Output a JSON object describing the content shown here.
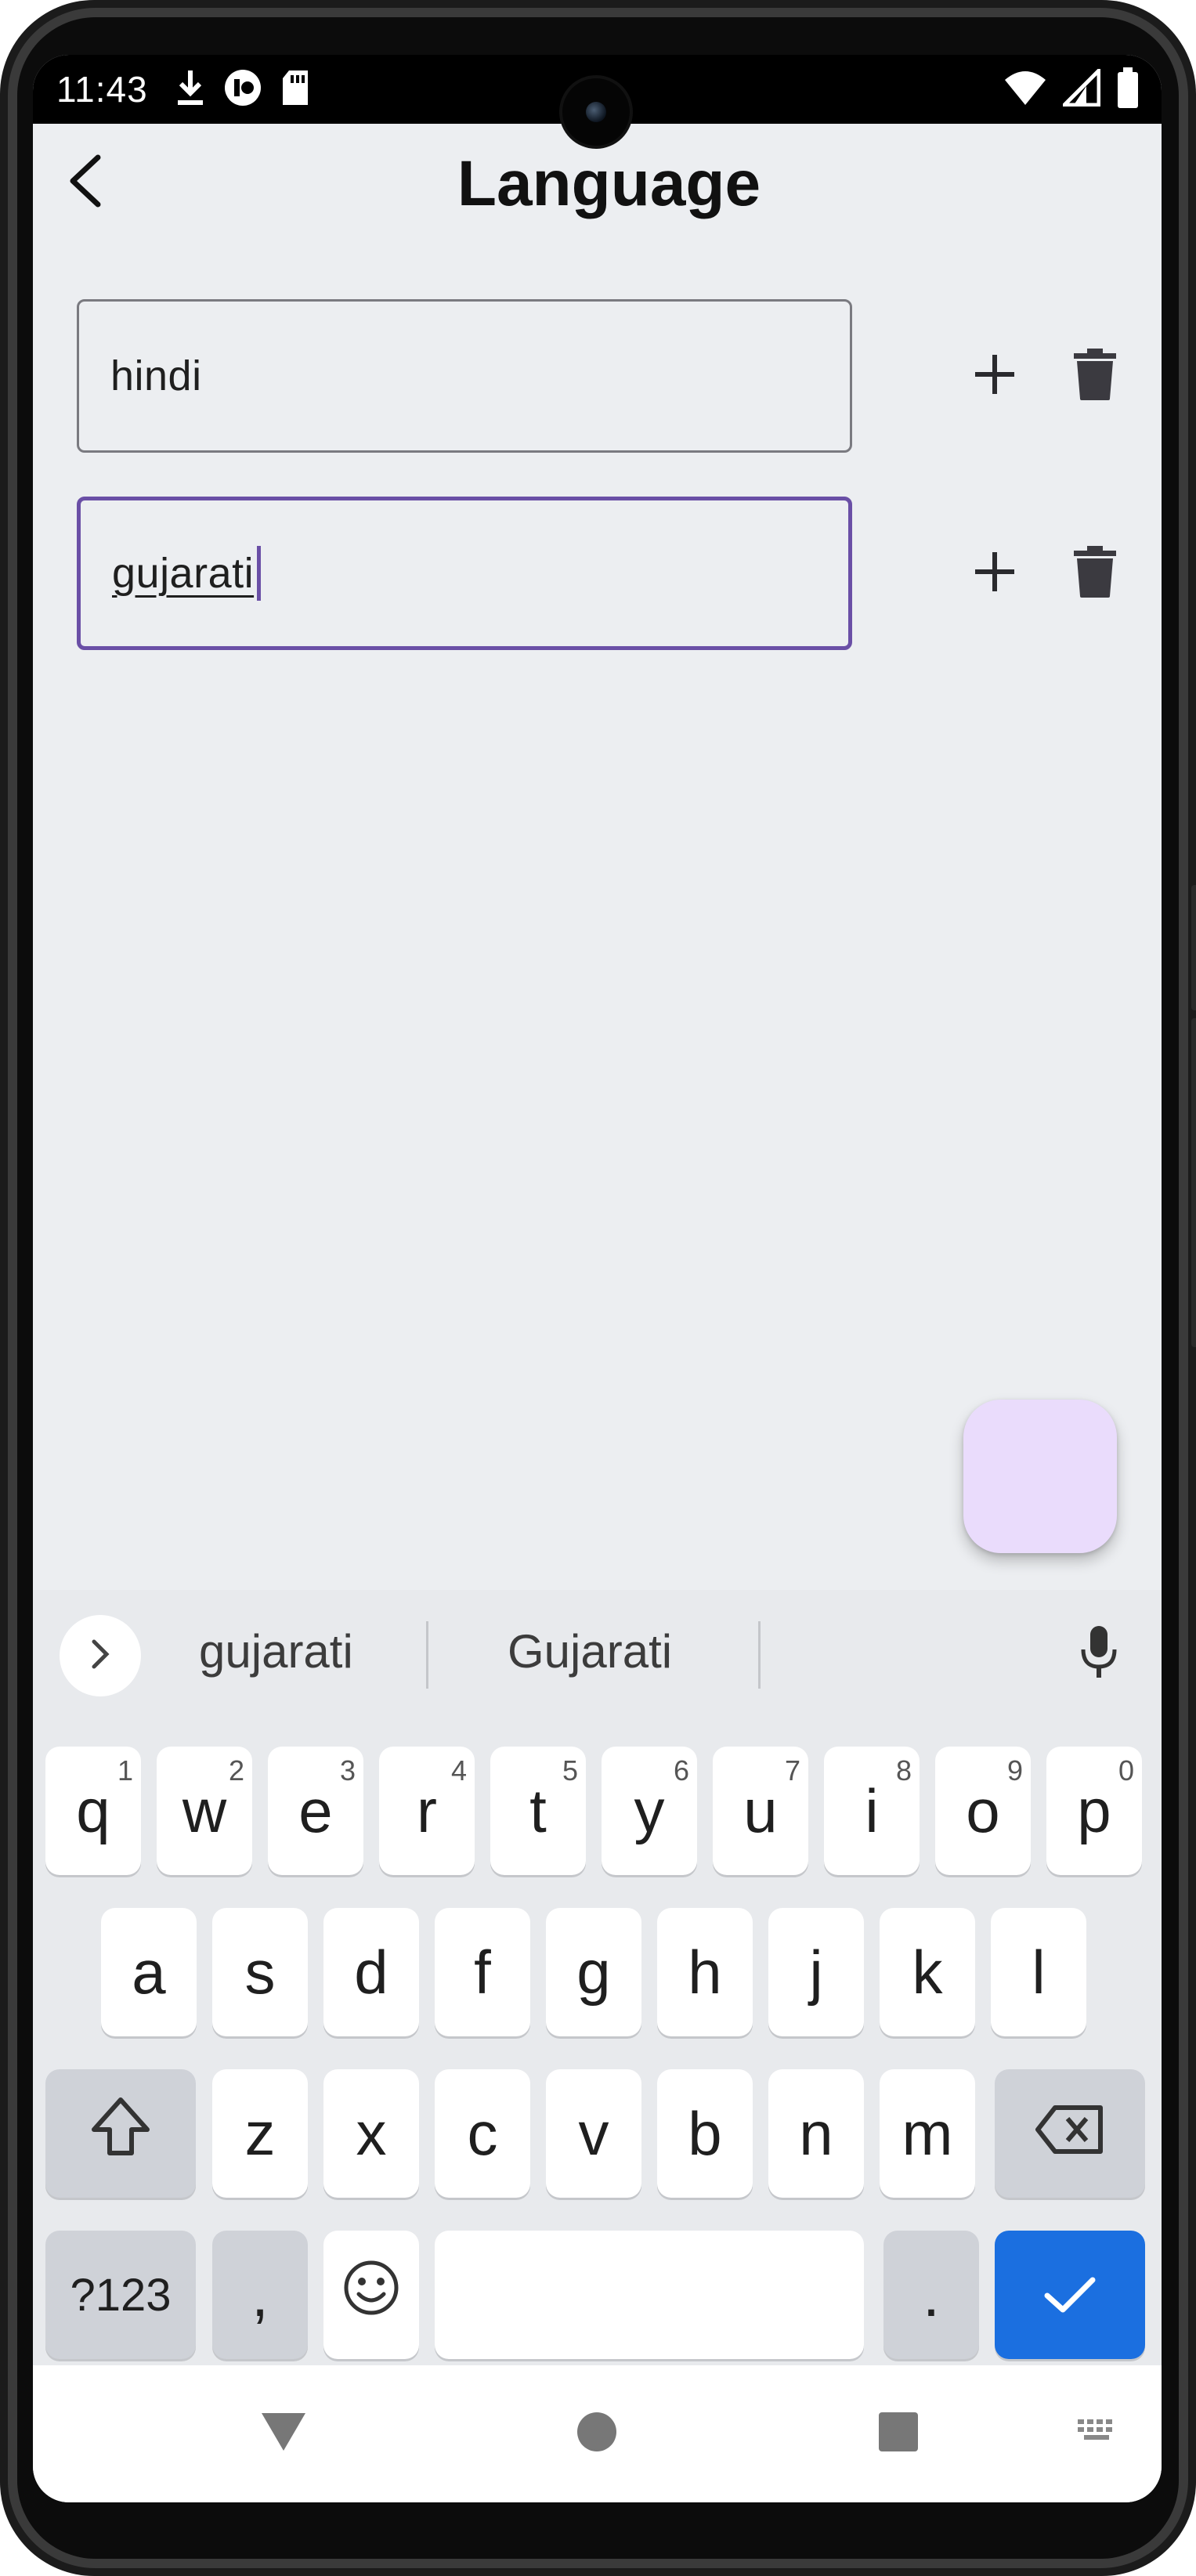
{
  "status_bar": {
    "time": "11:43",
    "left_icons": [
      "download-icon",
      "app-notification-icon",
      "sd-card-icon"
    ],
    "right_icons": [
      "wifi-icon",
      "cell-signal-icon",
      "battery-icon"
    ]
  },
  "app_bar": {
    "title": "Language",
    "back_icon": "back-arrow-icon"
  },
  "languages": [
    {
      "value": "hindi",
      "focused": false
    },
    {
      "value": "gujarati",
      "focused": true
    }
  ],
  "row_actions": {
    "add_icon": "plus-icon",
    "delete_icon": "trash-icon"
  },
  "fab": {
    "color": "#eadcfc"
  },
  "keyboard": {
    "suggestions": [
      "gujarati",
      "Gujarati"
    ],
    "row1": [
      {
        "label": "q",
        "hint": "1"
      },
      {
        "label": "w",
        "hint": "2"
      },
      {
        "label": "e",
        "hint": "3"
      },
      {
        "label": "r",
        "hint": "4"
      },
      {
        "label": "t",
        "hint": "5"
      },
      {
        "label": "y",
        "hint": "6"
      },
      {
        "label": "u",
        "hint": "7"
      },
      {
        "label": "i",
        "hint": "8"
      },
      {
        "label": "o",
        "hint": "9"
      },
      {
        "label": "p",
        "hint": "0"
      }
    ],
    "row2": [
      "a",
      "s",
      "d",
      "f",
      "g",
      "h",
      "j",
      "k",
      "l"
    ],
    "row3": [
      "z",
      "x",
      "c",
      "v",
      "b",
      "n",
      "m"
    ],
    "symbols_label": "?123",
    "comma_label": ",",
    "period_label": ".",
    "enter_color": "#1b6fe0"
  },
  "nav_bar": {
    "icons": [
      "back-triangle-icon",
      "home-circle-icon",
      "recents-square-icon",
      "keyboard-switch-icon"
    ]
  }
}
